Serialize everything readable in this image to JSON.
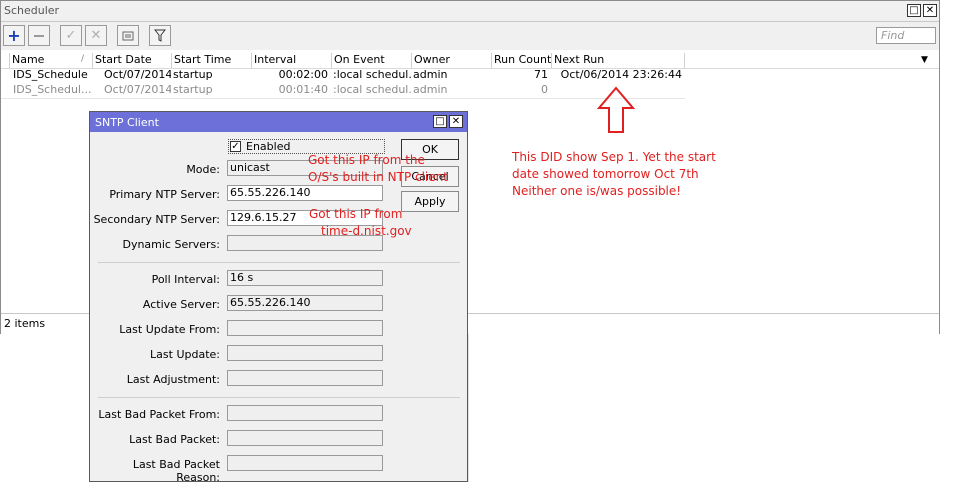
{
  "scheduler": {
    "title": "Scheduler",
    "minimize_glyph": "□",
    "close_glyph": "✕",
    "find_placeholder": "Find",
    "toolbar_icons": [
      "add-icon",
      "remove-icon",
      "enable-icon",
      "disable-icon",
      "comment-icon",
      "filter-icon"
    ],
    "columns": [
      "Name",
      "Start Date",
      "Start Time",
      "Interval",
      "On Event",
      "Owner",
      "Run Count",
      "Next Run"
    ],
    "rows": [
      {
        "name": "IDS_Schedule",
        "start_date": "Oct/07/2014",
        "start_time": "startup",
        "interval": "00:02:00",
        "on_event": ":local schedul...",
        "owner": "admin",
        "run_count": "71",
        "next_run": "Oct/06/2014 23:26:44",
        "disabled": false
      },
      {
        "name": "IDS_Schedul...",
        "start_date": "Oct/07/2014",
        "start_time": "startup",
        "interval": "00:01:40",
        "on_event": ":local schedul...",
        "owner": "admin",
        "run_count": "0",
        "next_run": "",
        "disabled": true
      }
    ],
    "status": "2 items"
  },
  "sntp": {
    "title": "SNTP Client",
    "enabled_label": "Enabled",
    "enabled_checked": true,
    "fields": {
      "mode": {
        "label": "Mode:",
        "value": "unicast"
      },
      "primary": {
        "label": "Primary NTP Server:",
        "value": "65.55.226.140"
      },
      "secondary": {
        "label": "Secondary NTP Server:",
        "value": "129.6.15.27"
      },
      "dynamic": {
        "label": "Dynamic Servers:",
        "value": ""
      },
      "poll": {
        "label": "Poll Interval:",
        "value": "16 s"
      },
      "active": {
        "label": "Active Server:",
        "value": "65.55.226.140"
      },
      "last_update_from": {
        "label": "Last Update From:",
        "value": ""
      },
      "last_update": {
        "label": "Last Update:",
        "value": ""
      },
      "last_adjustment": {
        "label": "Last Adjustment:",
        "value": ""
      },
      "bad_from": {
        "label": "Last Bad Packet From:",
        "value": ""
      },
      "bad_packet": {
        "label": "Last Bad Packet:",
        "value": ""
      },
      "bad_reason": {
        "label": "Last Bad Packet Reason:",
        "value": ""
      }
    },
    "buttons": {
      "ok": "OK",
      "cancel": "Cancel",
      "apply": "Apply"
    }
  },
  "annotations": {
    "ip_note_1": [
      "Got this IP from the",
      "O/S's built in NTP client"
    ],
    "ip_note_2": [
      "Got this IP from",
      "time-d.nist.gov"
    ],
    "date_note": [
      "This DID show Sep 1. Yet the start",
      "date showed tomorrow Oct 7th",
      "Neither one is/was possible!"
    ],
    "arrow_color": "#e02020"
  }
}
